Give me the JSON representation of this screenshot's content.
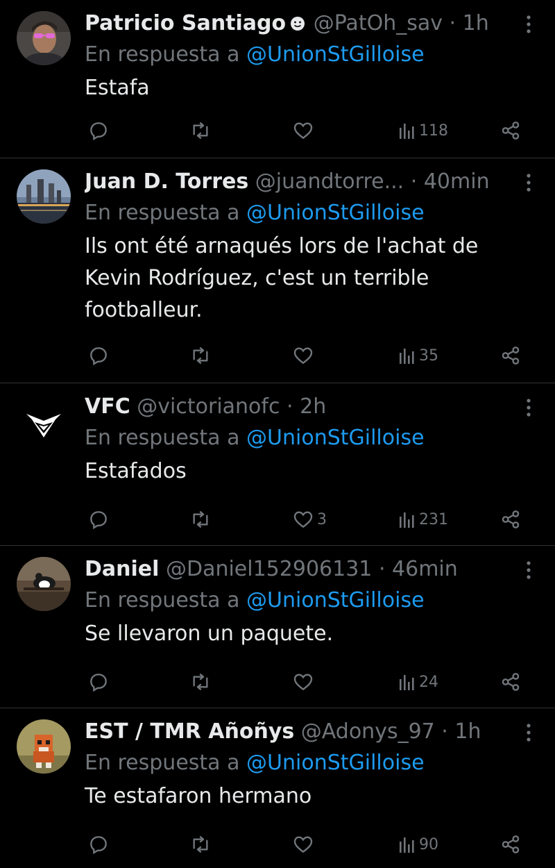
{
  "colors": {
    "background": "#000000",
    "text": "#e7e9ea",
    "muted": "#71767b",
    "mention": "#1d9bf0",
    "divider": "#2f3336"
  },
  "reply_prefix": "En respuesta a",
  "tweets": [
    {
      "name": "Patricio Santiago",
      "handle": "@PatOh_sav",
      "time": "1h",
      "reply_to": "@UnionStGilloise",
      "text": "Estafa",
      "replies": "",
      "retweets": "",
      "likes": "",
      "views": "118",
      "has_badge_icon": true
    },
    {
      "name": "Juan D. Torres",
      "handle": "@juandtorre...",
      "time": "40min",
      "reply_to": "@UnionStGilloise",
      "text": "Ils ont été arnaqués lors de l'achat de Kevin Rodríguez, c'est un terrible footballeur.",
      "replies": "",
      "retweets": "",
      "likes": "",
      "views": "35"
    },
    {
      "name": "VFC",
      "handle": "@victorianofc",
      "time": "2h",
      "reply_to": "@UnionStGilloise",
      "text": "Estafados",
      "replies": "",
      "retweets": "",
      "likes": "3",
      "views": "231"
    },
    {
      "name": "Daniel",
      "handle": "@Daniel152906131",
      "time": "46min",
      "reply_to": "@UnionStGilloise",
      "text": "Se llevaron un paquete.",
      "replies": "",
      "retweets": "",
      "likes": "",
      "views": "24"
    },
    {
      "name": "EST / TMR Añoñys",
      "handle": "@Adonys_97",
      "time": "1h",
      "reply_to": "@UnionStGilloise",
      "text": "Te estafaron hermano",
      "replies": "",
      "retweets": "",
      "likes": "",
      "views": "90"
    }
  ],
  "icons": {
    "reply": "reply-icon",
    "retweet": "retweet-icon",
    "like": "heart-icon",
    "views": "views-icon",
    "share": "share-icon",
    "more": "more-icon"
  }
}
